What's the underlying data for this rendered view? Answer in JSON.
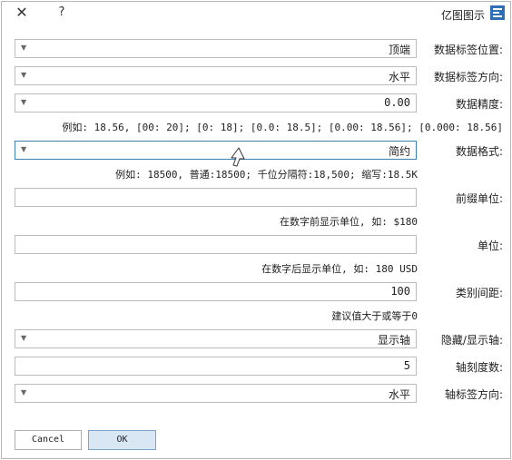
{
  "window": {
    "title": "亿图图示",
    "help_label": "?",
    "close_label": "✕"
  },
  "fields": {
    "label_position": {
      "label": "数据标签位置:",
      "value": "顶端"
    },
    "label_direction": {
      "label": "数据标签方向:",
      "value": "水平"
    },
    "precision": {
      "label": "数据精度:",
      "value": "0.00",
      "hint": "例如: 18.56, [00: 20]; [0: 18]; [0.0: 18.5]; [0.00: 18.56]; [0.000: 18.56]"
    },
    "format": {
      "label": "数据格式:",
      "value": "简约",
      "hint": "例如: 18500, 普通:18500; 千位分隔符:18,500; 缩写:18.5K"
    },
    "prefix_unit": {
      "label": "前缀单位:",
      "value": "",
      "hint": "在数字前显示单位, 如: $180"
    },
    "unit": {
      "label": "单位:",
      "value": "",
      "hint": "在数字后显示单位, 如: 180 USD"
    },
    "category_gap": {
      "label": "类别间距:",
      "value": "100",
      "hint": "建议值大于或等于0"
    },
    "show_axis": {
      "label": "隐藏/显示轴:",
      "value": "显示轴"
    },
    "tick_count": {
      "label": "轴刻度数:",
      "value": "5"
    },
    "axis_label_direction": {
      "label": "轴标签方向:",
      "value": "水平"
    }
  },
  "buttons": {
    "ok": "OK",
    "cancel": "Cancel"
  },
  "colors": {
    "accent_border": "#3c7fb1",
    "ok_bg": "#d9e6f3",
    "logo": "#2f6fb5"
  }
}
